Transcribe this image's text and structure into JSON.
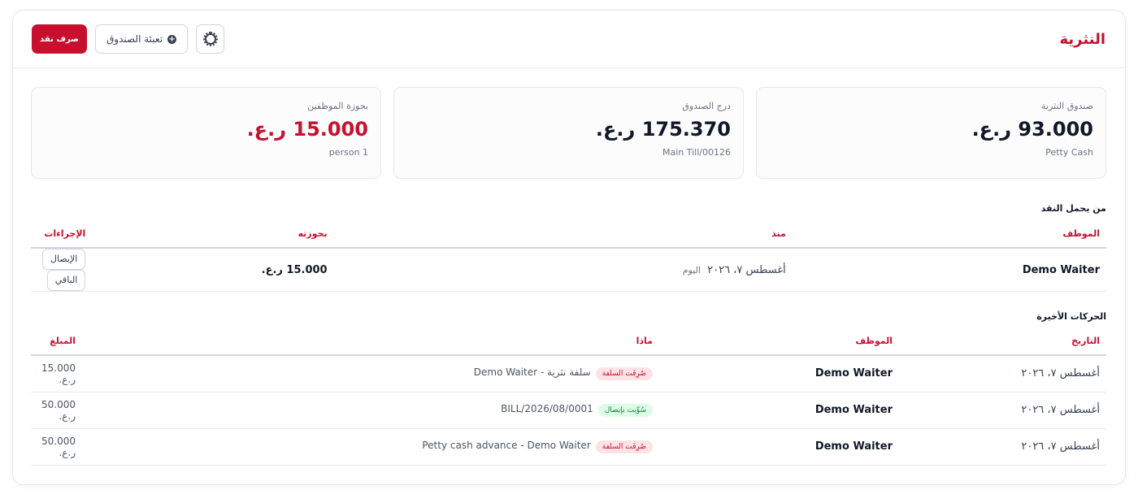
{
  "header": {
    "title": "النثرية",
    "spend_label": "صرف نقد",
    "refill_label": "تعبئة الصندوق",
    "settings_icon": "gear-icon",
    "refill_icon": "plus-circle-icon"
  },
  "stats": [
    {
      "label": "صندوق النثرية",
      "value": "93.000 ر.ع.",
      "sub": "Petty Cash"
    },
    {
      "label": "درج الصندوق",
      "value": "175.370 ر.ع.",
      "sub": "Main Till/00126"
    },
    {
      "label": "بحوزة الموظفين",
      "value": "15.000 ر.ع.",
      "sub": "1 person"
    }
  ],
  "holders": {
    "title": "من يحمل النقد",
    "columns": [
      "الموظف",
      "منذ",
      "بحوزته",
      "الإجراءات"
    ],
    "rows": [
      {
        "employee": "Demo Waiter",
        "since": "أغسطس ٧، ٢٠٢٦",
        "since_note": "اليوم",
        "holding": "15.000 ر.ع.",
        "receipt_label": "الإيصال",
        "remaining_label": "الباقي"
      }
    ]
  },
  "movements": {
    "title": "الحركات الأخيرة",
    "columns": [
      "التاريخ",
      "الموظف",
      "ماذا",
      "المبلغ"
    ],
    "rows": [
      {
        "date": "أغسطس ٧، ٢٠٢٦",
        "employee": "Demo Waiter",
        "badge": "صُرِفَت السلفة",
        "what": "سلفة نثرية - Demo Waiter",
        "amount": "15.000 ر.ع."
      },
      {
        "date": "أغسطس ٧، ٢٠٢٦",
        "employee": "Demo Waiter",
        "badge": "سُوِّيت بإيصال",
        "what": "BILL/2026/08/0001",
        "amount": "50.000 ر.ع."
      },
      {
        "date": "أغسطس ٧، ٢٠٢٦",
        "employee": "Demo Waiter",
        "badge": "صُرِفَت السلفة",
        "what": "Petty cash advance - Demo Waiter",
        "amount": "50.000 ر.ع."
      }
    ]
  },
  "colors": {
    "accent": "#c8102e",
    "badge_red_bg": "#fde2e6",
    "badge_green_bg": "#dcfce7"
  }
}
